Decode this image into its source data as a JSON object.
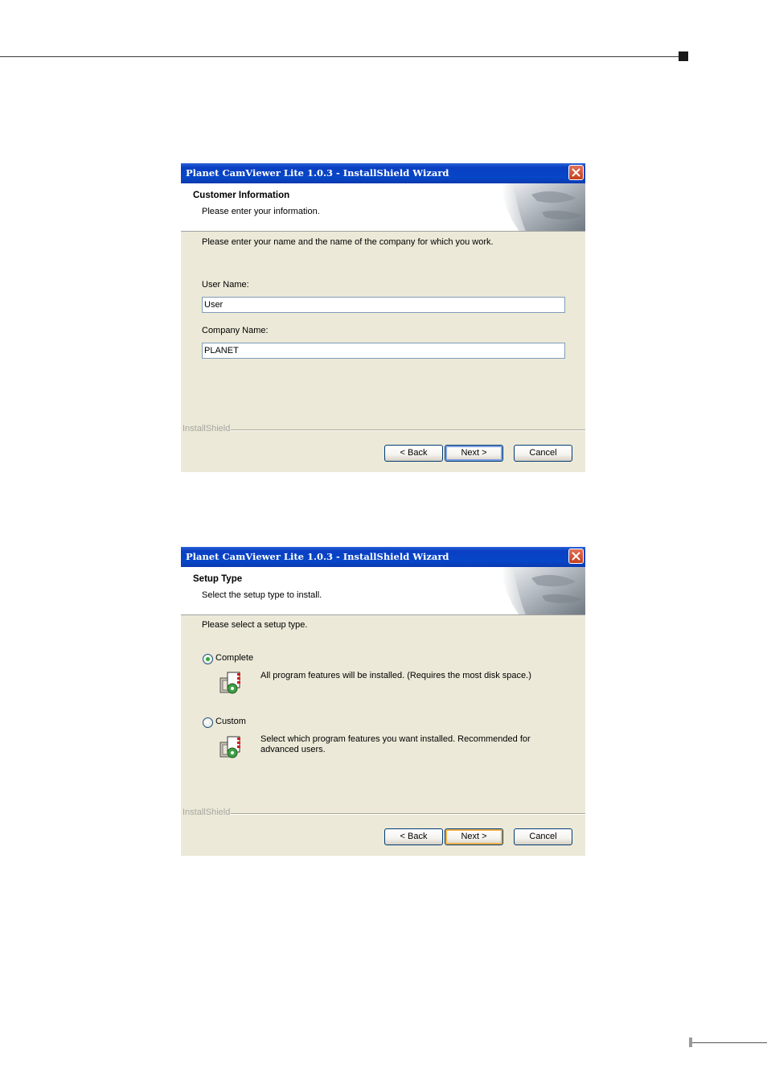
{
  "dialogs": {
    "customer": {
      "title": "Planet CamViewer Lite 1.0.3 - InstallShield Wizard",
      "header_title": "Customer Information",
      "header_subtitle": "Please enter your information.",
      "instruction": "Please enter your name and the name of the company for which you work.",
      "user_name_label": "User Name:",
      "user_name_value": "User",
      "company_name_label": "Company Name:",
      "company_name_value": "PLANET",
      "installshield_label": "InstallShield",
      "back_label": "< Back",
      "next_label": "Next >",
      "cancel_label": "Cancel"
    },
    "setup": {
      "title": "Planet CamViewer Lite 1.0.3 - InstallShield Wizard",
      "header_title": "Setup Type",
      "header_subtitle": "Select the setup type to install.",
      "instruction": "Please select a setup type.",
      "options": [
        {
          "label": "Complete",
          "selected": true,
          "description_line1": "All program features will be installed. (Requires the most disk space.)",
          "description_line2": ""
        },
        {
          "label": "Custom",
          "selected": false,
          "description_line1": "Select which program features you want installed. Recommended for",
          "description_line2": "advanced users."
        }
      ],
      "installshield_label": "InstallShield",
      "back_label": "< Back",
      "next_label": "Next >",
      "cancel_label": "Cancel"
    }
  },
  "colors": {
    "titlebar": "#0a46c8",
    "dialog_bg": "#ece9d8",
    "close_button": "#d4542e",
    "selected_radio": "#2fa83f"
  },
  "icons": {
    "close": "close-x-icon",
    "header_art": "page-curl-graphic",
    "setup_option": "install-package-icon"
  }
}
